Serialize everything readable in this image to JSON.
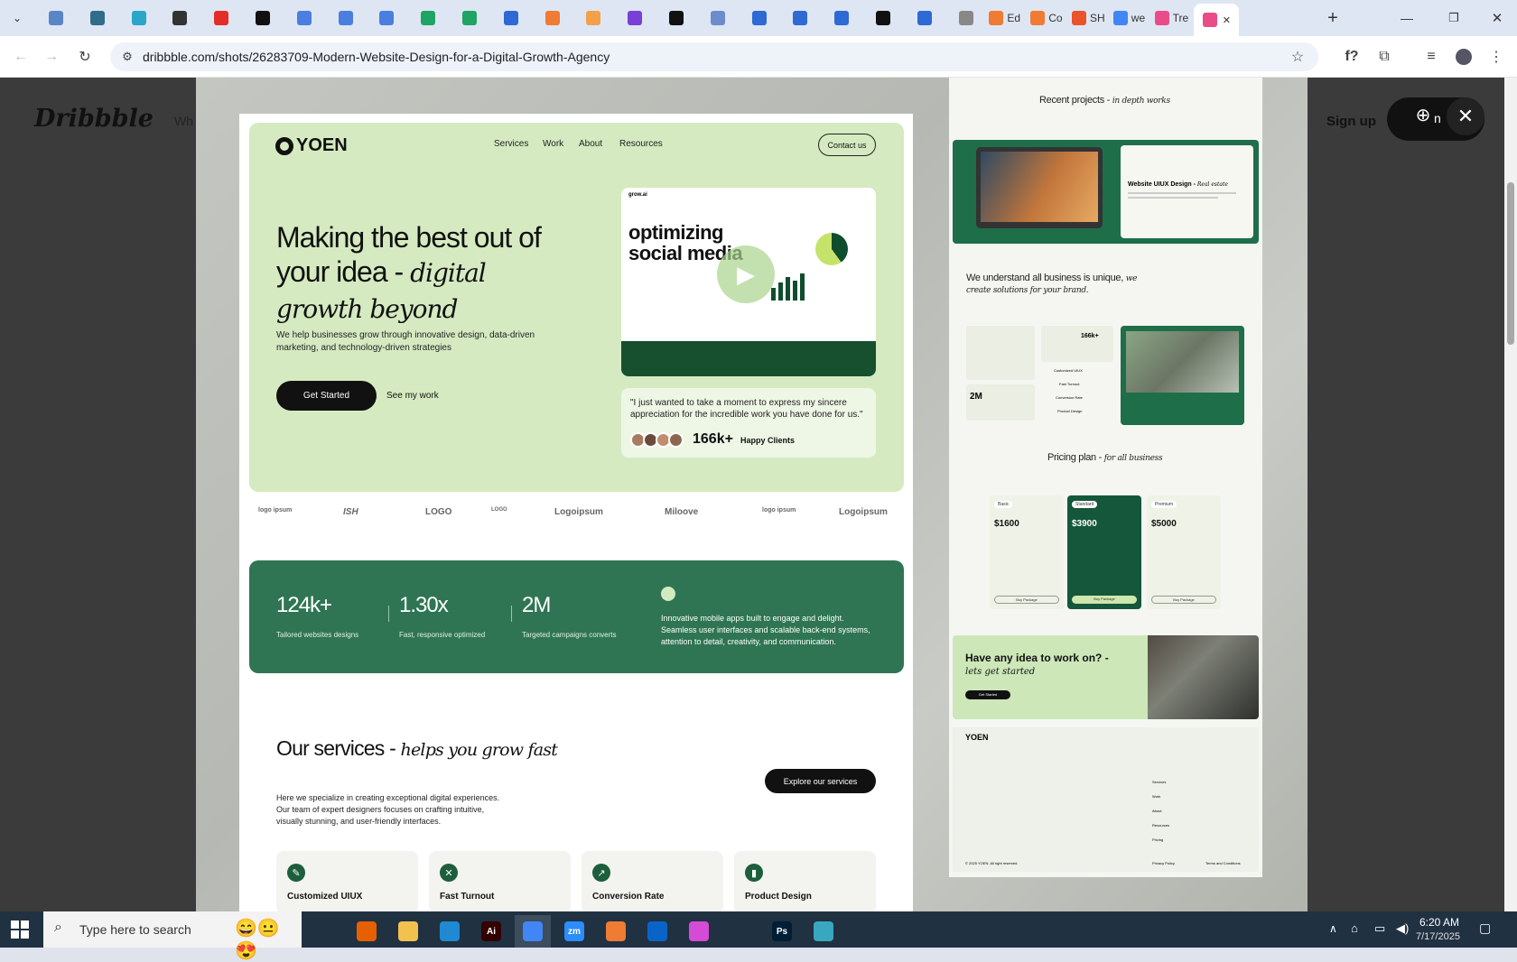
{
  "browser": {
    "tabs": [
      {
        "icon": "blue-circle-icon",
        "color": "#5a86c7",
        "label": ""
      },
      {
        "icon": "v-shield-icon",
        "color": "#2f6d8a",
        "label": ""
      },
      {
        "icon": "hex-icon",
        "color": "#2aa6c9",
        "label": ""
      },
      {
        "icon": "openai-icon",
        "color": "#333333",
        "label": ""
      },
      {
        "icon": "youtube-icon",
        "color": "#e52d27",
        "label": ""
      },
      {
        "icon": "bolt-icon",
        "color": "#111111",
        "label": ""
      },
      {
        "icon": "docs-icon",
        "color": "#4a7fe0",
        "label": ""
      },
      {
        "icon": "docs-icon",
        "color": "#4a7fe0",
        "label": ""
      },
      {
        "icon": "docs-icon",
        "color": "#4a7fe0",
        "label": ""
      },
      {
        "icon": "sheets-icon",
        "color": "#1fa463",
        "label": ""
      },
      {
        "icon": "sheets-icon",
        "color": "#1fa463",
        "label": ""
      },
      {
        "icon": "ms-icon",
        "color": "#2e69d4",
        "label": ""
      },
      {
        "icon": "box-icon",
        "color": "#f07b32",
        "label": ""
      },
      {
        "icon": "v-icon",
        "color": "#f2a14a",
        "label": ""
      },
      {
        "icon": "braces-icon",
        "color": "#7a3fd6",
        "label": ""
      },
      {
        "icon": "a-icon",
        "color": "#111111",
        "label": ""
      },
      {
        "icon": "grid-icon",
        "color": "#6d8ccc",
        "label": ""
      },
      {
        "icon": "framer-icon",
        "color": "#2e69d4",
        "label": ""
      },
      {
        "icon": "framer-icon",
        "color": "#2e69d4",
        "label": ""
      },
      {
        "icon": "framer-icon",
        "color": "#2e69d4",
        "label": ""
      },
      {
        "icon": "m-icon",
        "color": "#111111",
        "label": ""
      },
      {
        "icon": "framer-icon",
        "color": "#2e69d4",
        "label": ""
      },
      {
        "icon": "globe-icon",
        "color": "#888888",
        "label": ""
      },
      {
        "icon": "box-icon",
        "color": "#f07b32",
        "label": "Ed"
      },
      {
        "icon": "box-icon",
        "color": "#f07b32",
        "label": "Co"
      },
      {
        "icon": "ring-icon",
        "color": "#e9542b",
        "label": "SH"
      },
      {
        "icon": "google-icon",
        "color": "#4285f4",
        "label": "we"
      },
      {
        "icon": "dribbble-icon",
        "color": "#ea4c89",
        "label": "Tre"
      },
      {
        "icon": "dribbble-icon",
        "color": "#ea4c89",
        "label": ""
      }
    ],
    "new_tab": "+",
    "url": "dribbble.com/shots/26283709-Modern-Website-Design-for-a-Digital-Growth-Agency"
  },
  "dribbble": {
    "logo": "Dribbble",
    "search_stub": "Wh",
    "signup": "Sign up",
    "login_stub": "n"
  },
  "shot": {
    "brand": "YOEN",
    "nav": [
      "Services",
      "Work",
      "About",
      "Resources"
    ],
    "contact": "Contact us",
    "headline_a": "Making the best out of your idea - ",
    "headline_b": "digital growth beyond",
    "subtitle": "We help businesses grow through innovative design, data-driven marketing, and technology-driven strategies",
    "cta_primary": "Get Started",
    "cta_secondary": "See my work",
    "video_brand": "grow.ai",
    "video_headline": "optimizing social media",
    "quote": "\"I just wanted to take a moment to express my sincere appreciation for the incredible work you have done for us.\"",
    "happy_clients_num": "166k+",
    "happy_clients_label": "Happy Clients",
    "logos": [
      "logo ipsum",
      "ISH",
      "LOGO",
      "LOGO",
      "Logoipsum",
      "Miloove",
      "logo ipsum",
      "Logoipsum"
    ],
    "stats": [
      {
        "num": "124k+",
        "label": "Tailored websites designs"
      },
      {
        "num": "1.30x",
        "label": "Fast, responsive optimized"
      },
      {
        "num": "2M",
        "label": "Targeted campaigns converts"
      }
    ],
    "stats_desc": "Innovative mobile apps built to engage and delight. Seamless user interfaces and scalable back-end systems, attention to detail, creativity, and communication.",
    "services_title_a": "Our services - ",
    "services_title_b": "helps you grow fast",
    "services_desc": "Here we specialize in creating exceptional digital experiences. Our team of expert designers focuses on crafting intuitive, visually stunning, and user-friendly interfaces.",
    "services_btn": "Explore our services",
    "services": [
      "Customized UIUX",
      "Fast Turnout",
      "Conversion Rate",
      "Product Design"
    ]
  },
  "right_col": {
    "recent_a": "Recent projects - ",
    "recent_b": "in depth works",
    "case_title": "Website UIUX Design - ",
    "case_tag": "Real estate",
    "understand_a": "We understand all business is unique, ",
    "understand_b": "we create solutions for your brand.",
    "mini_clients": "166k+",
    "mini_stat": "2M",
    "mini_services": [
      "Customized UIUX",
      "Fast Turnout",
      "Conversion Rate",
      "Product Design"
    ],
    "pricing_a": "Pricing plan - ",
    "pricing_b": "for all business",
    "plans": [
      {
        "name": "Basic",
        "price": "$1600",
        "btn": "Buy Package"
      },
      {
        "name": "Standard",
        "price": "$3900",
        "btn": "Buy Package"
      },
      {
        "name": "Premium",
        "price": "$5000",
        "btn": "Buy Package"
      }
    ],
    "cta_a": "Have any idea to work on? - ",
    "cta_b": "lets get started",
    "cta_btn": "Get Started",
    "footer_brand": "YOEN",
    "footer_links": [
      "Services",
      "Work",
      "About",
      "Resources",
      "Pricing"
    ],
    "copyright": "© 2025 YOEN. All right reserved.",
    "privacy": "Privacy Policy",
    "terms": "Terms and Conditions"
  },
  "taskbar": {
    "search_placeholder": "Type here to search",
    "time": "6:20 AM",
    "date": "7/17/2025",
    "apps": [
      {
        "icon": "task-view-icon",
        "color": "#203142",
        "label": ""
      },
      {
        "icon": "firefox-icon",
        "color": "#e66000",
        "label": ""
      },
      {
        "icon": "folder-icon",
        "color": "#f2c14e",
        "label": ""
      },
      {
        "icon": "vscode-icon",
        "color": "#1f8ad2",
        "label": ""
      },
      {
        "icon": "illustrator-icon",
        "color": "#330000",
        "label": "Ai"
      },
      {
        "icon": "chrome-icon",
        "color": "#4285f4",
        "label": ""
      },
      {
        "icon": "zoom-icon",
        "color": "#2d8cff",
        "label": "zm"
      },
      {
        "icon": "xampp-icon",
        "color": "#f07b32",
        "label": ""
      },
      {
        "icon": "outlook-icon",
        "color": "#0a64c8",
        "label": ""
      },
      {
        "icon": "paint-icon",
        "color": "#d44bd6",
        "label": ""
      },
      {
        "icon": "pen-icon",
        "color": "#203142",
        "label": ""
      },
      {
        "icon": "photoshop-icon",
        "color": "#001e36",
        "label": "Ps"
      },
      {
        "icon": "cube-icon",
        "color": "#3aa7c0",
        "label": ""
      }
    ]
  }
}
